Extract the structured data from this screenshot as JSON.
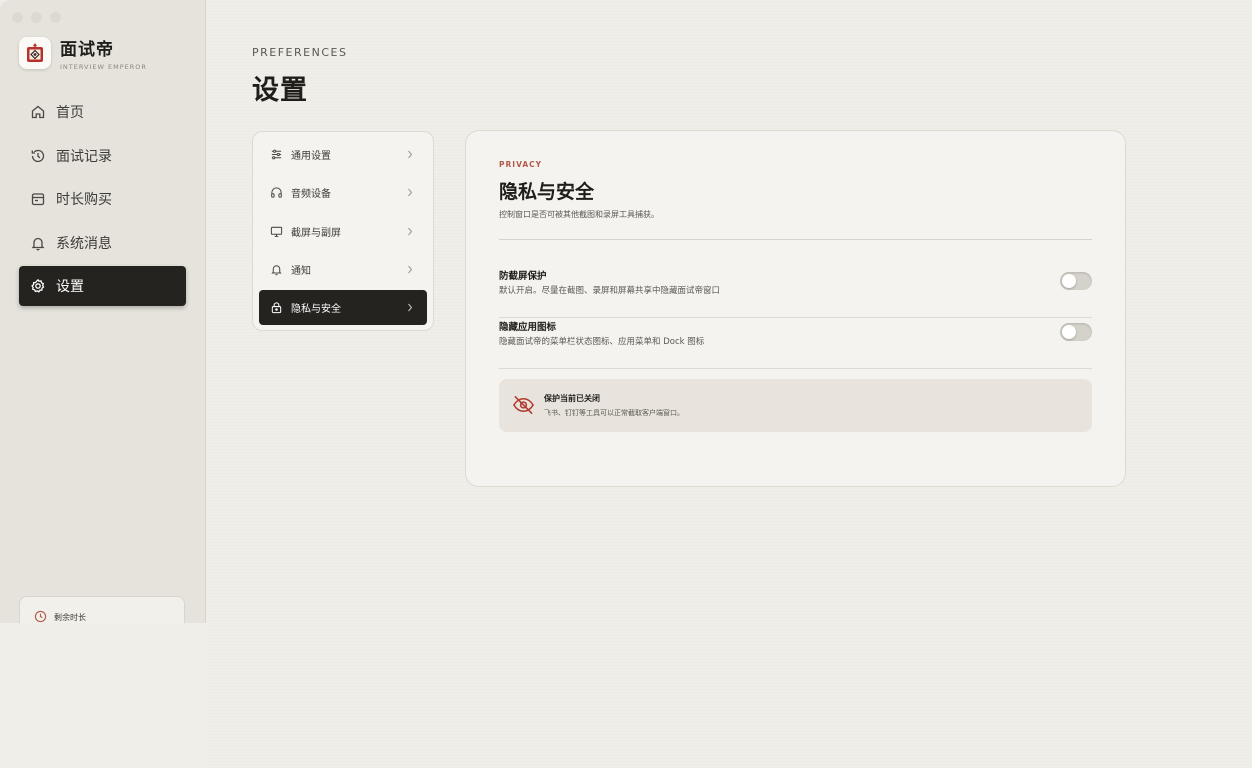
{
  "app": {
    "name": "面试帝",
    "subtitle": "INTERVIEW EMPEROR",
    "logo_icon": "emperor-seal-icon"
  },
  "sidebar": {
    "items": [
      {
        "label": "首页",
        "icon": "home-icon",
        "active": false
      },
      {
        "label": "面试记录",
        "icon": "history-icon",
        "active": false
      },
      {
        "label": "时长购买",
        "icon": "wallet-icon",
        "active": false
      },
      {
        "label": "系统消息",
        "icon": "bell-icon",
        "active": false
      },
      {
        "label": "设置",
        "icon": "gear-icon",
        "active": true
      }
    ],
    "remaining_label": "剩余时长"
  },
  "page": {
    "eyebrow": "PREFERENCES",
    "title": "设置"
  },
  "submenu": {
    "items": [
      {
        "label": "通用设置",
        "icon": "sliders-icon",
        "active": false
      },
      {
        "label": "音频设备",
        "icon": "headphones-icon",
        "active": false
      },
      {
        "label": "截屏与副屏",
        "icon": "monitor-icon",
        "active": false
      },
      {
        "label": "通知",
        "icon": "bell-icon",
        "active": false
      },
      {
        "label": "隐私与安全",
        "icon": "lock-icon",
        "active": true
      }
    ]
  },
  "panel": {
    "eyebrow": "PRIVACY",
    "title": "隐私与安全",
    "description": "控制窗口是否可被其他截图和录屏工具捕获。",
    "settings": [
      {
        "label": "防截屏保护",
        "description": "默认开启。尽量在截图、录屏和屏幕共享中隐藏面试帝窗口",
        "enabled": false
      },
      {
        "label": "隐藏应用图标",
        "description": "隐藏面试帝的菜单栏状态图标、应用菜单和 Dock 图标",
        "enabled": false
      }
    ],
    "notice": {
      "title": "保护当前已关闭",
      "description": "飞书、钉钉等工具可以正常截取客户端窗口。",
      "icon": "eye-off-icon"
    }
  },
  "colors": {
    "accent": "#b05a4a",
    "active_bg": "#242320",
    "background": "#efeee9"
  }
}
